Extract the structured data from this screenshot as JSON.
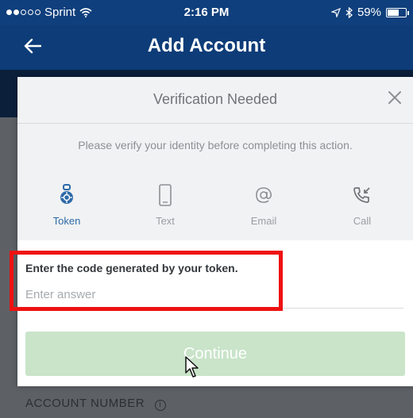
{
  "statusbar": {
    "carrier": "Sprint",
    "time": "2:16 PM",
    "battery": "59%",
    "icons": [
      "signal-dots-icon",
      "wifi-icon",
      "location-arrow-icon",
      "bluetooth-icon",
      "battery-icon"
    ]
  },
  "navbar": {
    "back_icon": "arrow-left-icon",
    "title": "Add Account"
  },
  "background": {
    "label": "ACCOUNT NUMBER",
    "info_icon": "info-circle-icon"
  },
  "modal": {
    "title": "Verification Needed",
    "close_icon": "close-icon",
    "description": "Please verify your identity before completing this action.",
    "methods": [
      {
        "label": "Token",
        "icon": "token-icon",
        "active": true
      },
      {
        "label": "Text",
        "icon": "phone-icon",
        "active": false
      },
      {
        "label": "Email",
        "icon": "at-sign-icon",
        "active": false
      },
      {
        "label": "Call",
        "icon": "phone-call-icon",
        "active": false
      }
    ],
    "field_label": "Enter the code generated by your token.",
    "field_placeholder": "Enter answer",
    "field_value": "",
    "continue_label": "Continue"
  },
  "colors": {
    "brand_blue": "#0d3c78",
    "active_method": "#2e6aa8",
    "highlight": "#ee1111",
    "continue_disabled": "#c9e4c9"
  }
}
